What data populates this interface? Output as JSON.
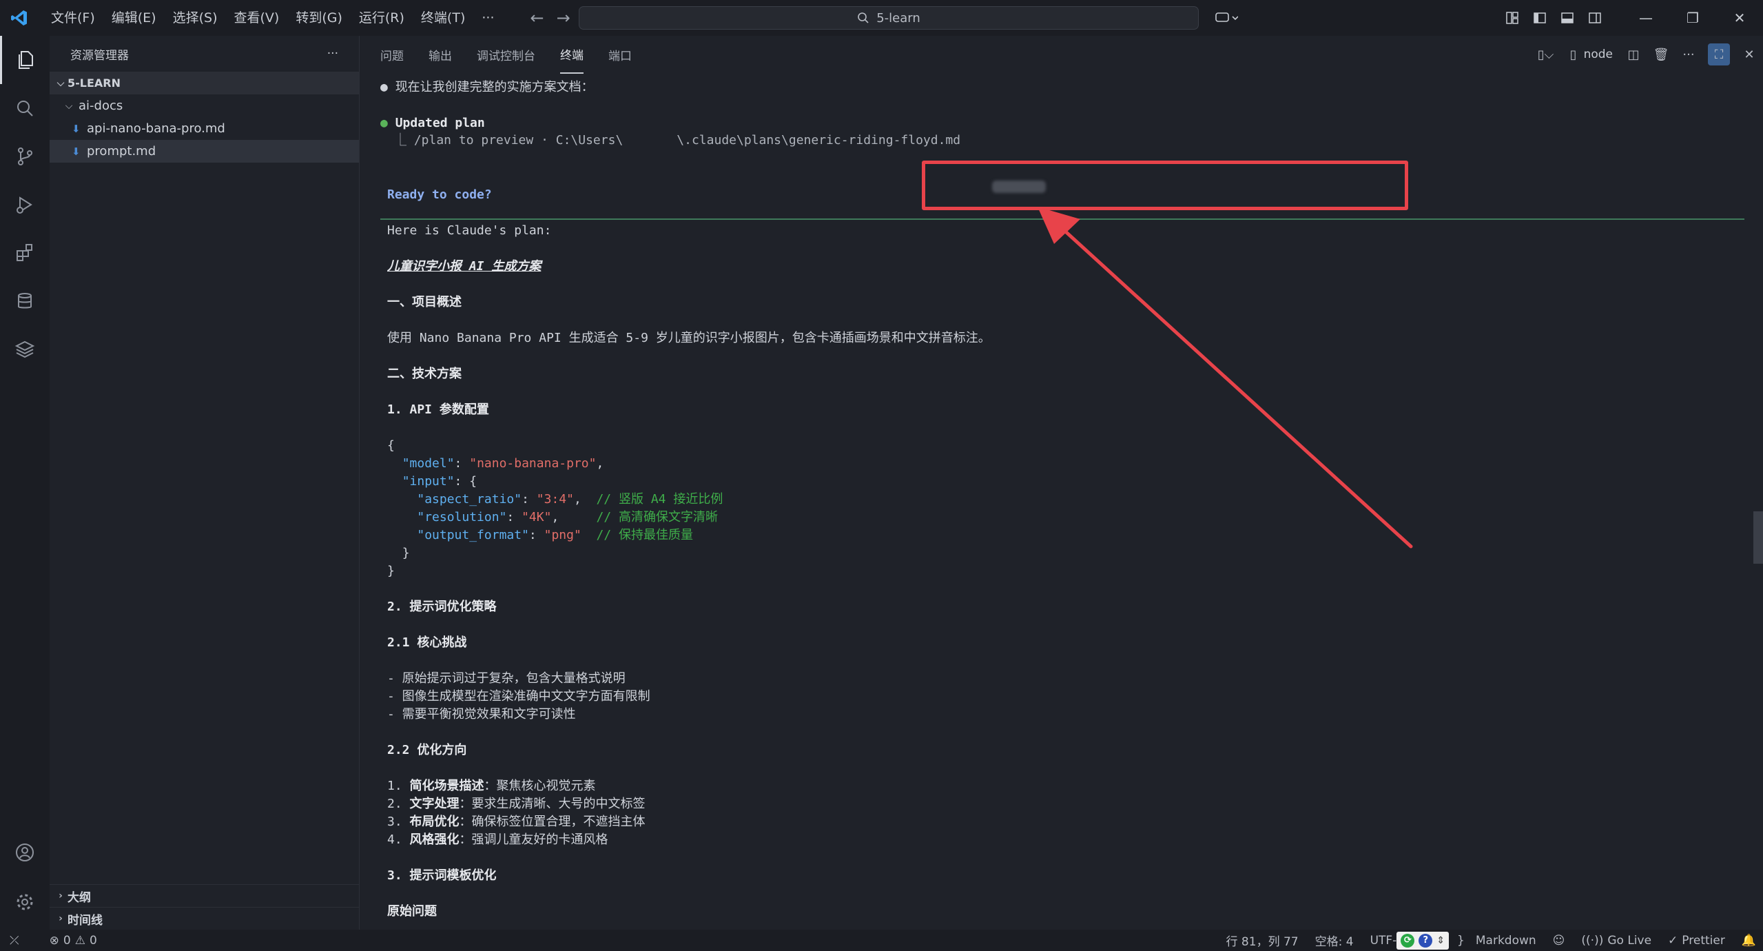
{
  "menu": [
    "文件(F)",
    "编辑(E)",
    "选择(S)",
    "查看(V)",
    "转到(G)",
    "运行(R)",
    "终端(T)",
    "···"
  ],
  "search": {
    "text": "5-learn"
  },
  "sidebar": {
    "header": "资源管理器",
    "more": "···",
    "root": "5-LEARN",
    "folder": "ai-docs",
    "files": [
      "api-nano-bana-pro.md",
      "prompt.md"
    ],
    "outline": "大纲",
    "timeline": "时间线"
  },
  "panel": {
    "tabs": [
      "问题",
      "输出",
      "调试控制台",
      "终端",
      "端口"
    ],
    "active_tab": "终端",
    "terminal_name": "node"
  },
  "terminal": {
    "l1": "现在让我创建完整的实施方案文档：",
    "l2_label": "Updated plan",
    "l3_prefix": "⎿ /plan to preview · ",
    "l3_path_a": "C:\\Users\\",
    "l3_path_b": "\\.claude\\plans\\generic-riding-floyd.md",
    "ready": "Ready to code?",
    "here": "Here is Claude's plan:",
    "title": "儿童识字小报 AI 生成方案",
    "s1": "一、项目概述",
    "s1_body": "使用 Nano Banana Pro API 生成适合 5-9 岁儿童的识字小报图片，包含卡通插画场景和中文拼音标注。",
    "s2": "二、技术方案",
    "s2_1": "1. API 参数配置",
    "code": {
      "open": "{",
      "model_key": "\"model\"",
      "model_val": "\"nano-banana-pro\"",
      "input_key": "\"input\"",
      "ar_key": "\"aspect_ratio\"",
      "ar_val": "\"3:4\"",
      "ar_cmt": "// 竖版 A4 接近比例",
      "res_key": "\"resolution\"",
      "res_val": "\"4K\"",
      "res_cmt": "// 高清确保文字清晰",
      "fmt_key": "\"output_format\"",
      "fmt_val": "\"png\"",
      "fmt_cmt": "// 保持最佳质量",
      "close_inner": "}",
      "close": "}"
    },
    "s2_2": "2. 提示词优化策略",
    "s2_2_1": "2.1 核心挑战",
    "bullets": [
      "- 原始提示词过于复杂，包含大量格式说明",
      "- 图像生成模型在渲染准确中文文字方面有限制",
      "- 需要平衡视觉效果和文字可读性"
    ],
    "s2_2_2": "2.2 优化方向",
    "items": [
      {
        "num": "1.",
        "label": "简化场景描述",
        "text": "：聚焦核心视觉元素"
      },
      {
        "num": "2.",
        "label": "文字处理",
        "text": "：要求生成清晰、大号的中文标签"
      },
      {
        "num": "3.",
        "label": "布局优化",
        "text": "：确保标签位置合理，不遮挡主体"
      },
      {
        "num": "4.",
        "label": "风格强化",
        "text": "：强调儿童友好的卡通风格"
      }
    ],
    "s2_3": "3. 提示词模板优化",
    "s2_3_1": "原始问题"
  },
  "status": {
    "errors": "0",
    "warnings": "0",
    "position": "行 81，列 77",
    "spaces": "空格: 4",
    "encoding": "UTF-",
    "language": "Markdown",
    "golive": "Go Live",
    "prettier": "Prettier"
  },
  "colors": {
    "highlight": "#e8434a",
    "accent": "#4b8bd4"
  }
}
